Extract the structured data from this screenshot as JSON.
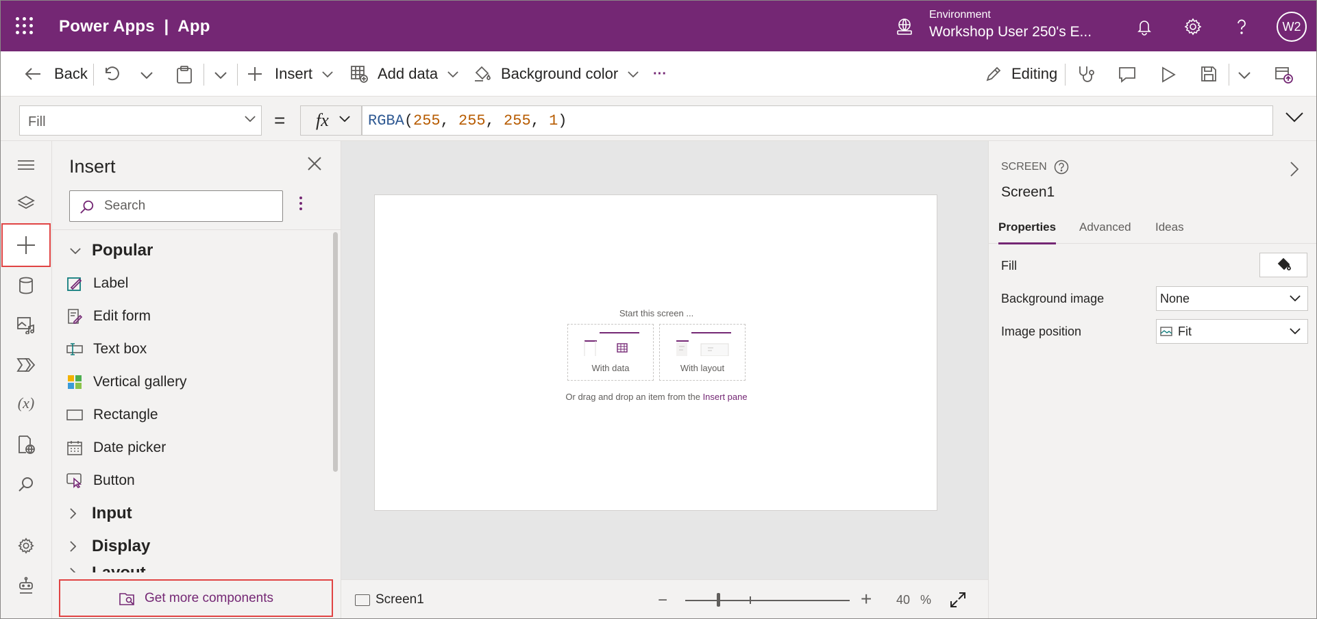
{
  "header": {
    "app_title": "Power Apps  |  App",
    "environment_label": "Environment",
    "environment_name": "Workshop User 250's E...",
    "avatar_initials": "W2",
    "brand_color": "#742774"
  },
  "commandbar": {
    "back": "Back",
    "insert": "Insert",
    "add_data": "Add data",
    "background_color": "Background color",
    "more": "···",
    "editing": "Editing"
  },
  "formulabar": {
    "property": "Fill",
    "equals": "=",
    "fx": "fx",
    "formula_fn": "RGBA",
    "formula_args": [
      "255",
      "255",
      "255",
      "1"
    ]
  },
  "rail": {
    "icons": [
      "hamburger-icon",
      "layers-icon",
      "plus-icon",
      "database-icon",
      "media-icon",
      "power-automate-icon",
      "variables-icon",
      "app-checker-icon",
      "search-icon",
      "settings-icon",
      "copilot-icon"
    ],
    "variables_glyph": "(x)"
  },
  "insert_pane": {
    "title": "Insert",
    "search_placeholder": "Search",
    "categories": {
      "popular": "Popular",
      "input": "Input",
      "display": "Display",
      "layout": "Layout"
    },
    "items": [
      "Label",
      "Edit form",
      "Text box",
      "Vertical gallery",
      "Rectangle",
      "Date picker",
      "Button"
    ],
    "get_more": "Get more components"
  },
  "canvas": {
    "start_text": "Start this screen ...",
    "with_data": "With data",
    "with_layout": "With layout",
    "drag_text": "Or drag and drop an item from the",
    "insert_pane_link": "Insert pane"
  },
  "status": {
    "screen_name": "Screen1",
    "zoom_value": "40",
    "zoom_unit": "%"
  },
  "properties": {
    "type": "SCREEN",
    "name": "Screen1",
    "tabs": [
      "Properties",
      "Advanced",
      "Ideas"
    ],
    "fill_label": "Fill",
    "background_image_label": "Background image",
    "background_image_value": "None",
    "image_position_label": "Image position",
    "image_position_value": "Fit"
  }
}
